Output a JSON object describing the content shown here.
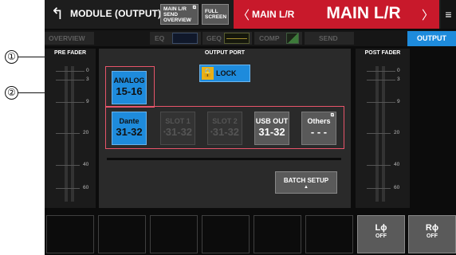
{
  "annotations": {
    "callout_1": "①",
    "callout_2": "②"
  },
  "header": {
    "back_icon": "↰",
    "title": "MODULE (OUTPUT)",
    "send_overview_label": "MAIN L/R SEND OVERVIEW",
    "send_overview_ext_icon": "⧉",
    "full_screen_label": "FULL SCREEN",
    "prev_icon": "〈",
    "channel_small": "MAIN L/R",
    "channel_big": "MAIN L/R",
    "next_icon": "〉",
    "menu_icon": "≡"
  },
  "tabs": {
    "overview": "OVERVIEW",
    "eq": "EQ",
    "geq": "GEQ",
    "comp": "COMP",
    "send": "SEND",
    "output": "OUTPUT"
  },
  "meters": {
    "pre_fader_title": "PRE FADER",
    "post_fader_title": "POST FADER",
    "scale": [
      "0",
      "3",
      "9",
      "20",
      "40",
      "60"
    ]
  },
  "output_port": {
    "title": "OUTPUT PORT",
    "lock_label": "LOCK",
    "lock_icon": "🔒",
    "analog": {
      "label": "ANALOG",
      "value": "15-16"
    },
    "dante": {
      "label": "Dante",
      "value": "31-32"
    },
    "slot1": {
      "label": "SLOT 1",
      "value": "31-32",
      "dot": "•"
    },
    "slot2": {
      "label": "SLOT 2",
      "value": "31-32",
      "dot": "•"
    },
    "usb_out": {
      "label": "USB OUT",
      "value": "31-32"
    },
    "others": {
      "label": "Others",
      "value": "- - -",
      "ext_icon": "⧉"
    },
    "batch_setup": "BATCH SETUP",
    "batch_arrow": "▲"
  },
  "bottom": {
    "l_phase": {
      "label": "Lϕ",
      "state": "OFF"
    },
    "r_phase": {
      "label": "Rϕ",
      "state": "OFF"
    }
  },
  "colors": {
    "accent_blue": "#1e8bdc",
    "title_red": "#c8192b",
    "highlight_frame": "#e8556a",
    "lock_yellow": "#e9b017"
  }
}
